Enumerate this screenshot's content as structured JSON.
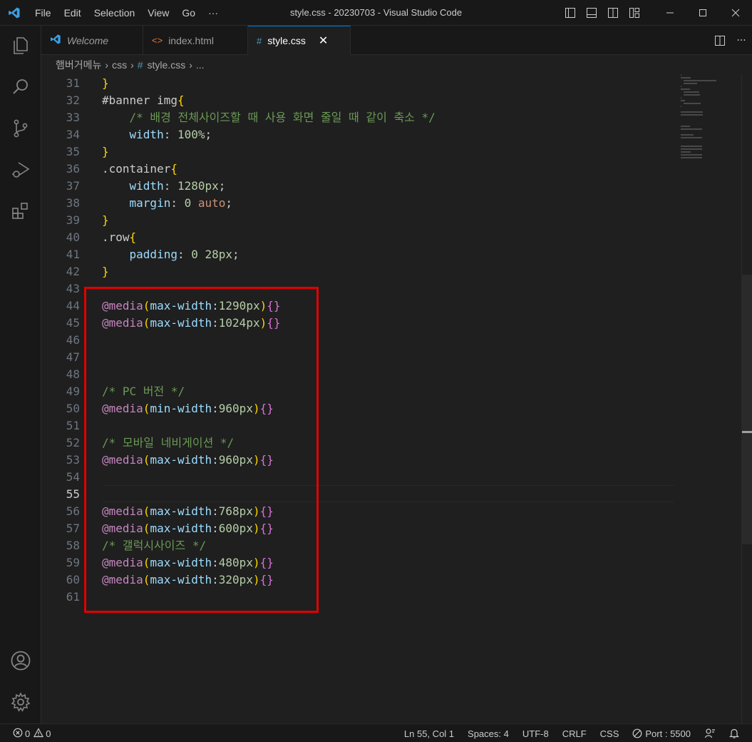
{
  "window": {
    "title": "style.css - 20230703 - Visual Studio Code",
    "menu": [
      "File",
      "Edit",
      "Selection",
      "View",
      "Go",
      "···"
    ]
  },
  "tabs": [
    {
      "label": "Welcome",
      "icon": "vscode-icon",
      "active": false
    },
    {
      "label": "index.html",
      "icon": "html-icon",
      "active": false
    },
    {
      "label": "style.css",
      "icon": "css-hash-icon",
      "active": true
    }
  ],
  "breadcrumb": [
    "햄버거메뉴",
    "css",
    "style.css",
    "..."
  ],
  "editor": {
    "current_line": 55,
    "lines": [
      {
        "n": "31",
        "tokens": [
          [
            "brace",
            "}"
          ]
        ]
      },
      {
        "n": "32",
        "tokens": [
          [
            "plain",
            "#banner img"
          ],
          [
            "brace",
            "{"
          ]
        ]
      },
      {
        "n": "33",
        "tokens": [
          [
            "plain",
            "    "
          ],
          [
            "cm",
            "/* 배경 전체사이즈할 때 사용 화면 줄일 때 같이 축소 */"
          ]
        ]
      },
      {
        "n": "34",
        "tokens": [
          [
            "plain",
            "    "
          ],
          [
            "prop",
            "width"
          ],
          [
            "plain",
            ": "
          ],
          [
            "num",
            "100%"
          ],
          [
            "plain",
            ";"
          ]
        ]
      },
      {
        "n": "35",
        "tokens": [
          [
            "brace",
            "}"
          ]
        ]
      },
      {
        "n": "36",
        "tokens": [
          [
            "plain",
            ".container"
          ],
          [
            "brace",
            "{"
          ]
        ]
      },
      {
        "n": "37",
        "tokens": [
          [
            "plain",
            "    "
          ],
          [
            "prop",
            "width"
          ],
          [
            "plain",
            ": "
          ],
          [
            "num",
            "1280px"
          ],
          [
            "plain",
            ";"
          ]
        ]
      },
      {
        "n": "38",
        "tokens": [
          [
            "plain",
            "    "
          ],
          [
            "prop",
            "margin"
          ],
          [
            "plain",
            ": "
          ],
          [
            "num",
            "0"
          ],
          [
            "plain",
            " "
          ],
          [
            "kw",
            "auto"
          ],
          [
            "plain",
            ";"
          ]
        ]
      },
      {
        "n": "39",
        "tokens": [
          [
            "brace",
            "}"
          ]
        ]
      },
      {
        "n": "40",
        "tokens": [
          [
            "plain",
            ".row"
          ],
          [
            "brace",
            "{"
          ]
        ]
      },
      {
        "n": "41",
        "tokens": [
          [
            "plain",
            "    "
          ],
          [
            "prop",
            "padding"
          ],
          [
            "plain",
            ": "
          ],
          [
            "num",
            "0"
          ],
          [
            "plain",
            " "
          ],
          [
            "num",
            "28px"
          ],
          [
            "plain",
            ";"
          ]
        ]
      },
      {
        "n": "42",
        "tokens": [
          [
            "brace",
            "}"
          ]
        ]
      },
      {
        "n": "43",
        "tokens": []
      },
      {
        "n": "44",
        "tokens": [
          [
            "at",
            "@media"
          ],
          [
            "brace",
            "("
          ],
          [
            "prop",
            "max-width"
          ],
          [
            "plain",
            ":"
          ],
          [
            "num",
            "1290px"
          ],
          [
            "brace",
            ")"
          ],
          [
            "paren",
            "{}"
          ]
        ]
      },
      {
        "n": "45",
        "tokens": [
          [
            "at",
            "@media"
          ],
          [
            "brace",
            "("
          ],
          [
            "prop",
            "max-width"
          ],
          [
            "plain",
            ":"
          ],
          [
            "num",
            "1024px"
          ],
          [
            "brace",
            ")"
          ],
          [
            "paren",
            "{}"
          ]
        ]
      },
      {
        "n": "46",
        "tokens": []
      },
      {
        "n": "47",
        "tokens": []
      },
      {
        "n": "48",
        "tokens": []
      },
      {
        "n": "49",
        "tokens": [
          [
            "cm",
            "/* PC 버전 */"
          ]
        ]
      },
      {
        "n": "50",
        "tokens": [
          [
            "at",
            "@media"
          ],
          [
            "brace",
            "("
          ],
          [
            "prop",
            "min-width"
          ],
          [
            "plain",
            ":"
          ],
          [
            "num",
            "960px"
          ],
          [
            "brace",
            ")"
          ],
          [
            "paren",
            "{}"
          ]
        ]
      },
      {
        "n": "51",
        "tokens": []
      },
      {
        "n": "52",
        "tokens": [
          [
            "cm",
            "/* 모바일 네비게이션 */"
          ]
        ]
      },
      {
        "n": "53",
        "tokens": [
          [
            "at",
            "@media"
          ],
          [
            "brace",
            "("
          ],
          [
            "prop",
            "max-width"
          ],
          [
            "plain",
            ":"
          ],
          [
            "num",
            "960px"
          ],
          [
            "brace",
            ")"
          ],
          [
            "paren",
            "{}"
          ]
        ]
      },
      {
        "n": "54",
        "tokens": []
      },
      {
        "n": "55",
        "tokens": []
      },
      {
        "n": "56",
        "tokens": [
          [
            "at",
            "@media"
          ],
          [
            "brace",
            "("
          ],
          [
            "prop",
            "max-width"
          ],
          [
            "plain",
            ":"
          ],
          [
            "num",
            "768px"
          ],
          [
            "brace",
            ")"
          ],
          [
            "paren",
            "{}"
          ]
        ]
      },
      {
        "n": "57",
        "tokens": [
          [
            "at",
            "@media"
          ],
          [
            "brace",
            "("
          ],
          [
            "prop",
            "max-width"
          ],
          [
            "plain",
            ":"
          ],
          [
            "num",
            "600px"
          ],
          [
            "brace",
            ")"
          ],
          [
            "paren",
            "{}"
          ]
        ]
      },
      {
        "n": "58",
        "tokens": [
          [
            "cm",
            "/* 갤럭시사이즈 */"
          ]
        ]
      },
      {
        "n": "59",
        "tokens": [
          [
            "at",
            "@media"
          ],
          [
            "brace",
            "("
          ],
          [
            "prop",
            "max-width"
          ],
          [
            "plain",
            ":"
          ],
          [
            "num",
            "480px"
          ],
          [
            "brace",
            ")"
          ],
          [
            "paren",
            "{}"
          ]
        ]
      },
      {
        "n": "60",
        "tokens": [
          [
            "at",
            "@media"
          ],
          [
            "brace",
            "("
          ],
          [
            "prop",
            "max-width"
          ],
          [
            "plain",
            ":"
          ],
          [
            "num",
            "320px"
          ],
          [
            "brace",
            ")"
          ],
          [
            "paren",
            "{}"
          ]
        ]
      },
      {
        "n": "61",
        "tokens": []
      }
    ]
  },
  "statusbar": {
    "errors": "0",
    "warnings": "0",
    "position": "Ln 55, Col 1",
    "spaces": "Spaces: 4",
    "encoding": "UTF-8",
    "eol": "CRLF",
    "language": "CSS",
    "port": "Port : 5500"
  },
  "colors": {
    "accent": "#0078d4",
    "highlight_box": "#e00000",
    "vscode_blue": "#3c9ee5",
    "html_icon": "#e37933",
    "css_icon": "#519aba"
  }
}
